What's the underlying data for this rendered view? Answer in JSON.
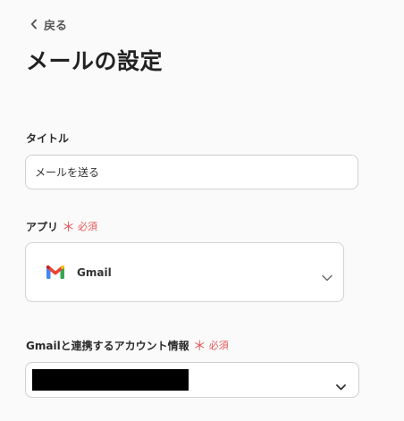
{
  "nav": {
    "back_label": "戻る",
    "back_icon": "chevron-left-icon"
  },
  "page": {
    "title": "メールの設定"
  },
  "fields": {
    "title": {
      "label": "タイトル",
      "value": "メールを送る"
    },
    "app": {
      "label": "アプリ",
      "required_mark": "＊",
      "required_text": "必須",
      "selected_app": "Gmail",
      "app_icon": "gmail-icon"
    },
    "account": {
      "label": "Gmailと連携するアカウント情報",
      "required_mark": "＊",
      "required_text": "必須",
      "value_redacted": true
    }
  },
  "colors": {
    "background": "#fbfafa",
    "required": "#e35a5a",
    "input_border": "#cfcfd6",
    "text": "#2b2b2b"
  }
}
